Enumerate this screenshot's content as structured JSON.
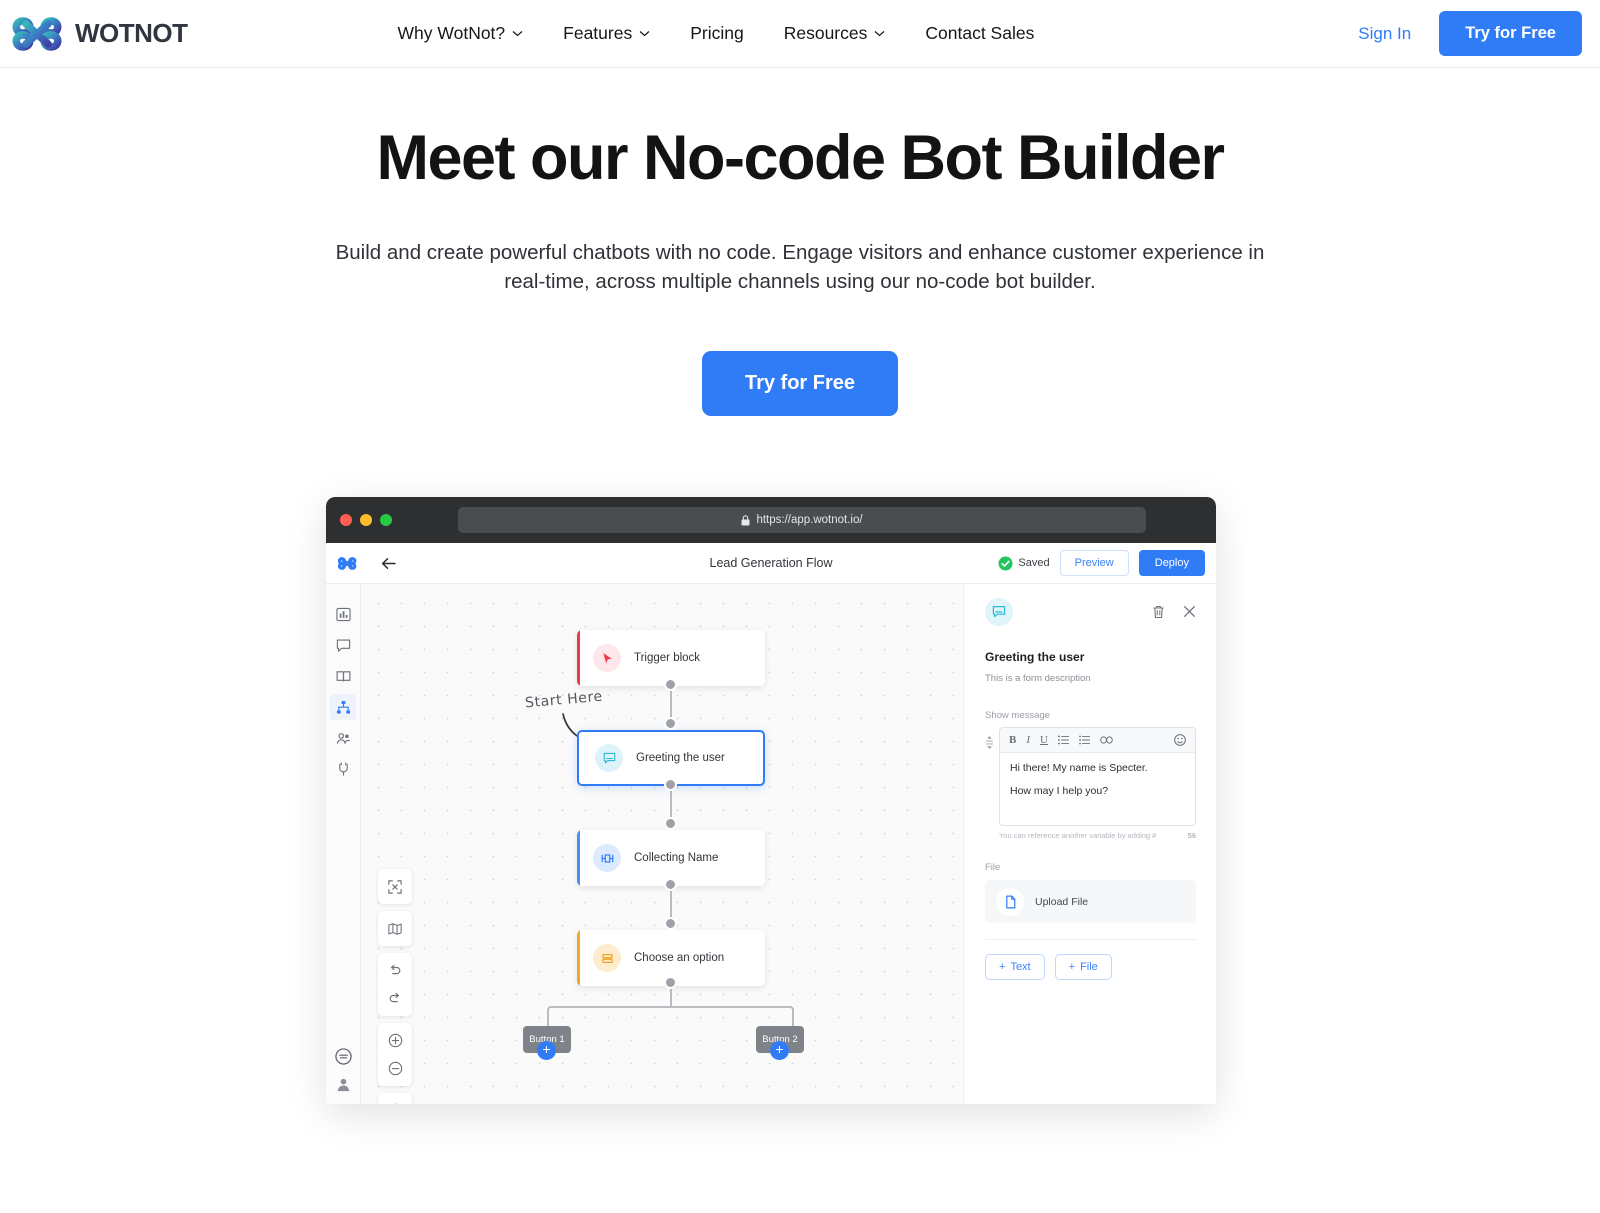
{
  "nav": {
    "brand": "WOTNOT",
    "links": [
      {
        "label": "Why WotNot?",
        "has_caret": true,
        "icon": "chevron-down-icon"
      },
      {
        "label": "Features",
        "has_caret": true,
        "icon": "chevron-down-icon"
      },
      {
        "label": "Pricing",
        "has_caret": false
      },
      {
        "label": "Resources",
        "has_caret": true,
        "icon": "chevron-down-icon"
      },
      {
        "label": "Contact Sales",
        "has_caret": false
      }
    ],
    "signin": "Sign In",
    "cta": "Try for Free"
  },
  "hero": {
    "title": "Meet our No-code Bot Builder",
    "subtitle": "Build and create powerful chatbots with no code. Engage visitors and enhance customer experience in real-time, across multiple channels using our no-code bot builder.",
    "cta": "Try for Free"
  },
  "mockup": {
    "browser": {
      "url": "https://app.wotnot.io/",
      "lock_icon": "lock-icon",
      "dots": [
        "close-dot",
        "minimize-dot",
        "maximize-dot"
      ]
    },
    "app_header": {
      "logo_icon": "wotnot-logo-icon",
      "back_icon": "back-arrow-icon",
      "flow_title": "Lead Generation Flow",
      "saved_label": "Saved",
      "saved_icon": "check-circle-icon",
      "preview_label": "Preview",
      "deploy_label": "Deploy"
    },
    "rail_icons": [
      {
        "name": "dashboard-icon",
        "active": false
      },
      {
        "name": "chat-icon",
        "active": false
      },
      {
        "name": "book-icon",
        "active": false
      },
      {
        "name": "sitemap-icon",
        "active": true
      },
      {
        "name": "users-icon",
        "active": false
      },
      {
        "name": "plug-icon",
        "active": false
      }
    ],
    "rail_bottom_icons": [
      {
        "name": "collapse-circle-icon"
      },
      {
        "name": "user-avatar-icon"
      }
    ],
    "canvas_tools": [
      {
        "name": "fit-screen-icon"
      },
      {
        "name": "map-icon"
      },
      {
        "name": "undo-icon"
      },
      {
        "name": "redo-icon"
      },
      {
        "name": "zoom-in-icon"
      },
      {
        "name": "zoom-out-icon"
      },
      {
        "name": "history-clock-icon"
      }
    ],
    "canvas": {
      "start_here": "Start Here",
      "nodes": [
        {
          "label": "Trigger block",
          "icon": "cursor-icon",
          "accent": "#f2384a",
          "bubble": "#fde7ea",
          "selected": false
        },
        {
          "label": "Greeting the user",
          "icon": "chat-bubble-icon",
          "accent": "#2f7cf6",
          "bubble": "#ddf3fa",
          "selected": true
        },
        {
          "label": "Collecting Name",
          "icon": "form-input-icon",
          "accent": "#4a90f0",
          "bubble": "#dbeafe",
          "selected": false
        },
        {
          "label": "Choose an option",
          "icon": "list-options-icon",
          "accent": "#f5a623",
          "bubble": "#fdeccd",
          "selected": false
        }
      ],
      "buttons": [
        {
          "label": "Button 1",
          "plus": "+"
        },
        {
          "label": "Button 2",
          "plus": "+"
        }
      ]
    },
    "panel": {
      "header_icon": "chat-bubble-icon",
      "delete_icon": "trash-icon",
      "close_icon": "close-icon",
      "title": "Greeting the user",
      "description": "This is a form description",
      "message_label": "Show message",
      "drag_icon": "drag-handle-icon",
      "toolbar": [
        {
          "name": "bold-icon",
          "glyph": "B"
        },
        {
          "name": "italic-icon",
          "glyph": "I"
        },
        {
          "name": "underline-icon",
          "glyph": "U"
        },
        {
          "name": "bullet-list-icon"
        },
        {
          "name": "numbered-list-icon"
        },
        {
          "name": "link-icon"
        },
        {
          "name": "emoji-icon"
        }
      ],
      "message_lines": [
        "Hi there! My name is Specter.",
        "How may I help you?"
      ],
      "hint": "You can reference another variable by adding #",
      "char_count": "56",
      "file_label": "File",
      "upload_icon": "file-upload-icon",
      "upload_text": "Upload File",
      "add_text_label": "Text",
      "add_file_label": "File",
      "add_plus": "+"
    }
  },
  "colors": {
    "accent": "#2f7cf6",
    "link": "#2f7cf6",
    "text": "#15171a",
    "rail_active": "#2f7cf6"
  }
}
